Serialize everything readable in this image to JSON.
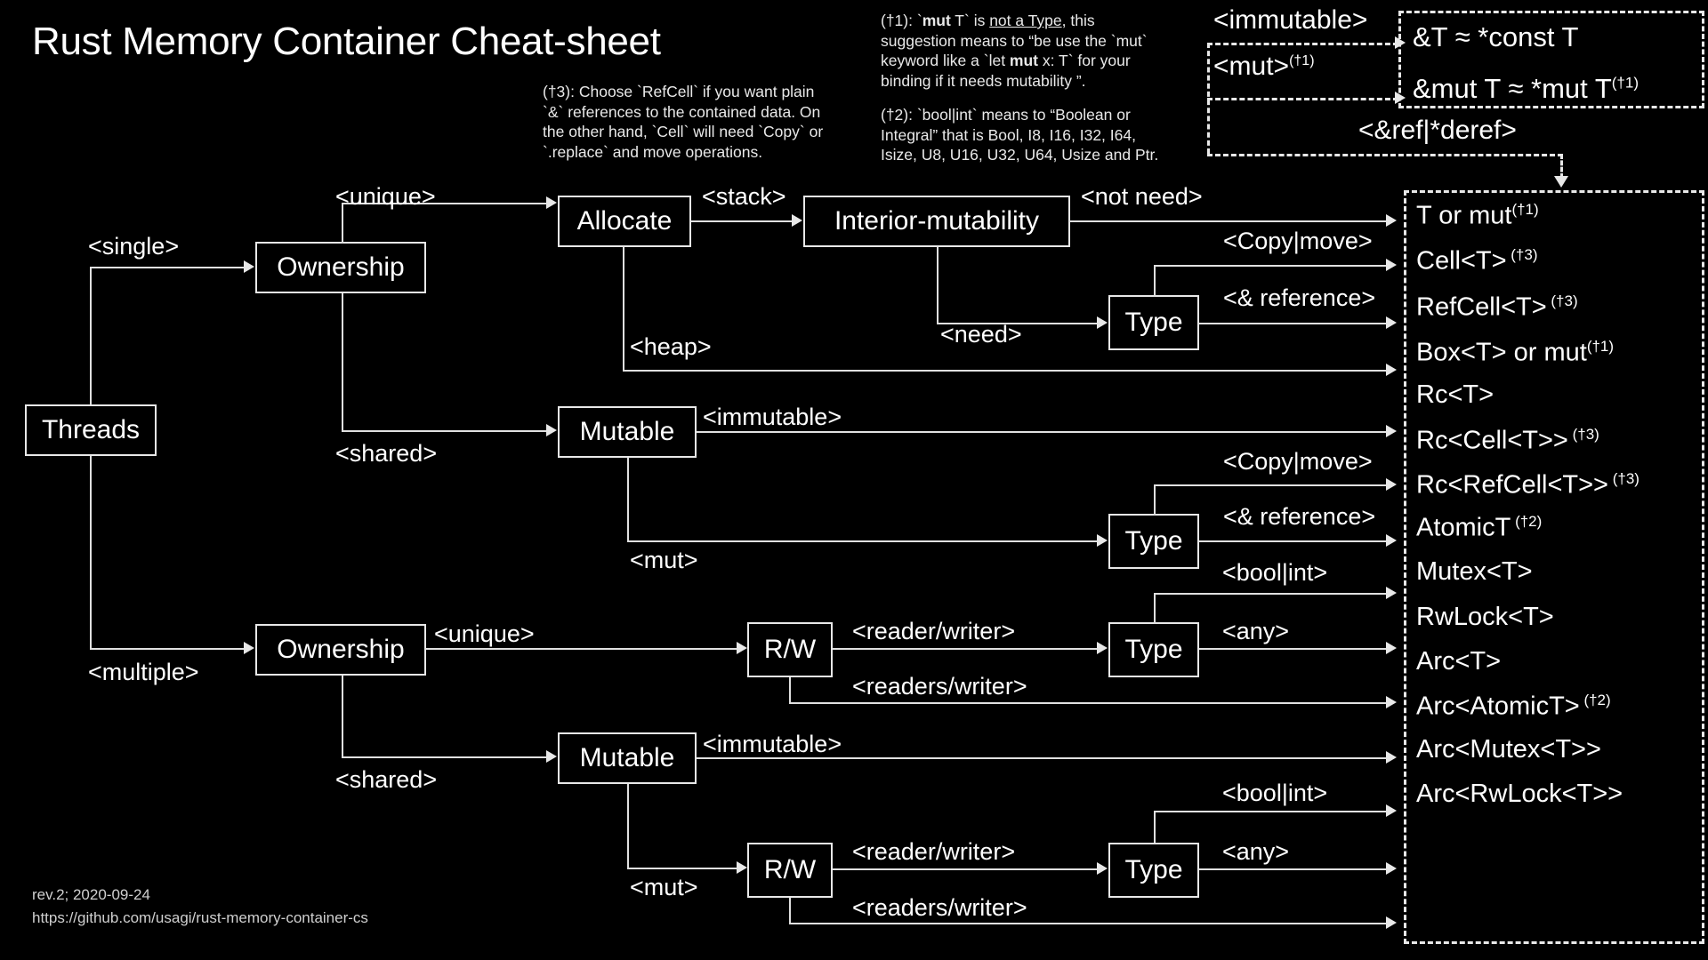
{
  "title": "Rust Memory Container Cheat-sheet",
  "notes": {
    "n3_line1": "(†3): Choose `RefCell` if you want plain",
    "n3_line2": "`&` references to the contained data. On",
    "n3_line3": "the other hand, `Cell` will need `Copy` or",
    "n3_line4": "`.replace` and move operations.",
    "n1_a": "(†1): `",
    "n1_b": "mut",
    "n1_c": " T` is ",
    "n1_d": "not a Type",
    "n1_e": ", this",
    "n1_line2": "suggestion means to “be use the `mut`",
    "n1_line3a": "keyword like a `let ",
    "n1_line3b": "mut",
    "n1_line3c": " x: T` for your",
    "n1_line4": "binding if it needs mutability ”.",
    "n2_line1": "(†2): `bool|int` means to “Boolean or",
    "n2_line2": "Integral” that is Bool, I8, I16, I32, I64,",
    "n2_line3": "Isize, U8, U16, U32, U64,  Usize and Ptr."
  },
  "refpanel": {
    "immutable_label": "<immutable>",
    "mut_label": "<mut>",
    "mut_sup": "(†1)",
    "deref_label": "<&ref|*deref>",
    "ref_const": "&T ≈ *const T",
    "ref_mut": "&mut T ≈ *mut T",
    "ref_mut_sup": "(†1)"
  },
  "nodes": {
    "threads": "Threads",
    "ownership_single": "Ownership",
    "ownership_multiple": "Ownership",
    "allocate": "Allocate",
    "interior_mutability": "Interior-mutability",
    "type_a": "Type",
    "mutable_single": "Mutable",
    "type_b": "Type",
    "rw_single": "R/W",
    "type_c": "Type",
    "mutable_multi": "Mutable",
    "rw_multi": "R/W",
    "type_d": "Type"
  },
  "edges": {
    "single": "<single>",
    "multiple": "<multiple>",
    "unique_top": "<unique>",
    "shared_top": "<shared>",
    "unique_bottom": "<unique>",
    "shared_bottom": "<shared>",
    "stack": "<stack>",
    "heap": "<heap>",
    "not_need": "<not need>",
    "need": "<need>",
    "copy_move_a": "<Copy|move>",
    "ref_a": "<& reference>",
    "immutable_a": "<immutable>",
    "mut_a": "<mut>",
    "copy_move_b": "<Copy|move>",
    "ref_b": "<& reference>",
    "reader_writer_a": "<reader/writer>",
    "readers_writer_a": "<readers/writer>",
    "bool_int_a": "<bool|int>",
    "any_a": "<any>",
    "immutable_b": "<immutable>",
    "mut_b": "<mut>",
    "reader_writer_b": "<reader/writer>",
    "readers_writer_b": "<readers/writer>",
    "bool_int_b": "<bool|int>",
    "any_b": "<any>"
  },
  "outputs": [
    {
      "text": "T or mut",
      "sup": "(†1)"
    },
    {
      "text": "Cell<T>",
      "sup": " (†3)"
    },
    {
      "text": "RefCell<T>",
      "sup": " (†3)"
    },
    {
      "text": "Box<T> or mut",
      "sup": "(†1)"
    },
    {
      "text": "Rc<T>",
      "sup": ""
    },
    {
      "text": "Rc<Cell<T>>",
      "sup": " (†3)"
    },
    {
      "text": "Rc<RefCell<T>>",
      "sup": " (†3)"
    },
    {
      "text": "AtomicT",
      "sup": " (†2)"
    },
    {
      "text": "Mutex<T>",
      "sup": ""
    },
    {
      "text": "RwLock<T>",
      "sup": ""
    },
    {
      "text": "Arc<T>",
      "sup": ""
    },
    {
      "text": "Arc<AtomicT>",
      "sup": " (†2)"
    },
    {
      "text": "Arc<Mutex<T>>",
      "sup": ""
    },
    {
      "text": "Arc<RwLock<T>>",
      "sup": ""
    }
  ],
  "footer": {
    "rev": "rev.2; 2020-09-24",
    "url": "https://github.com/usagi/rust-memory-container-cs"
  },
  "colors": {
    "background": "#000000",
    "stroke": "#e8e8e8",
    "text": "#ffffff"
  }
}
